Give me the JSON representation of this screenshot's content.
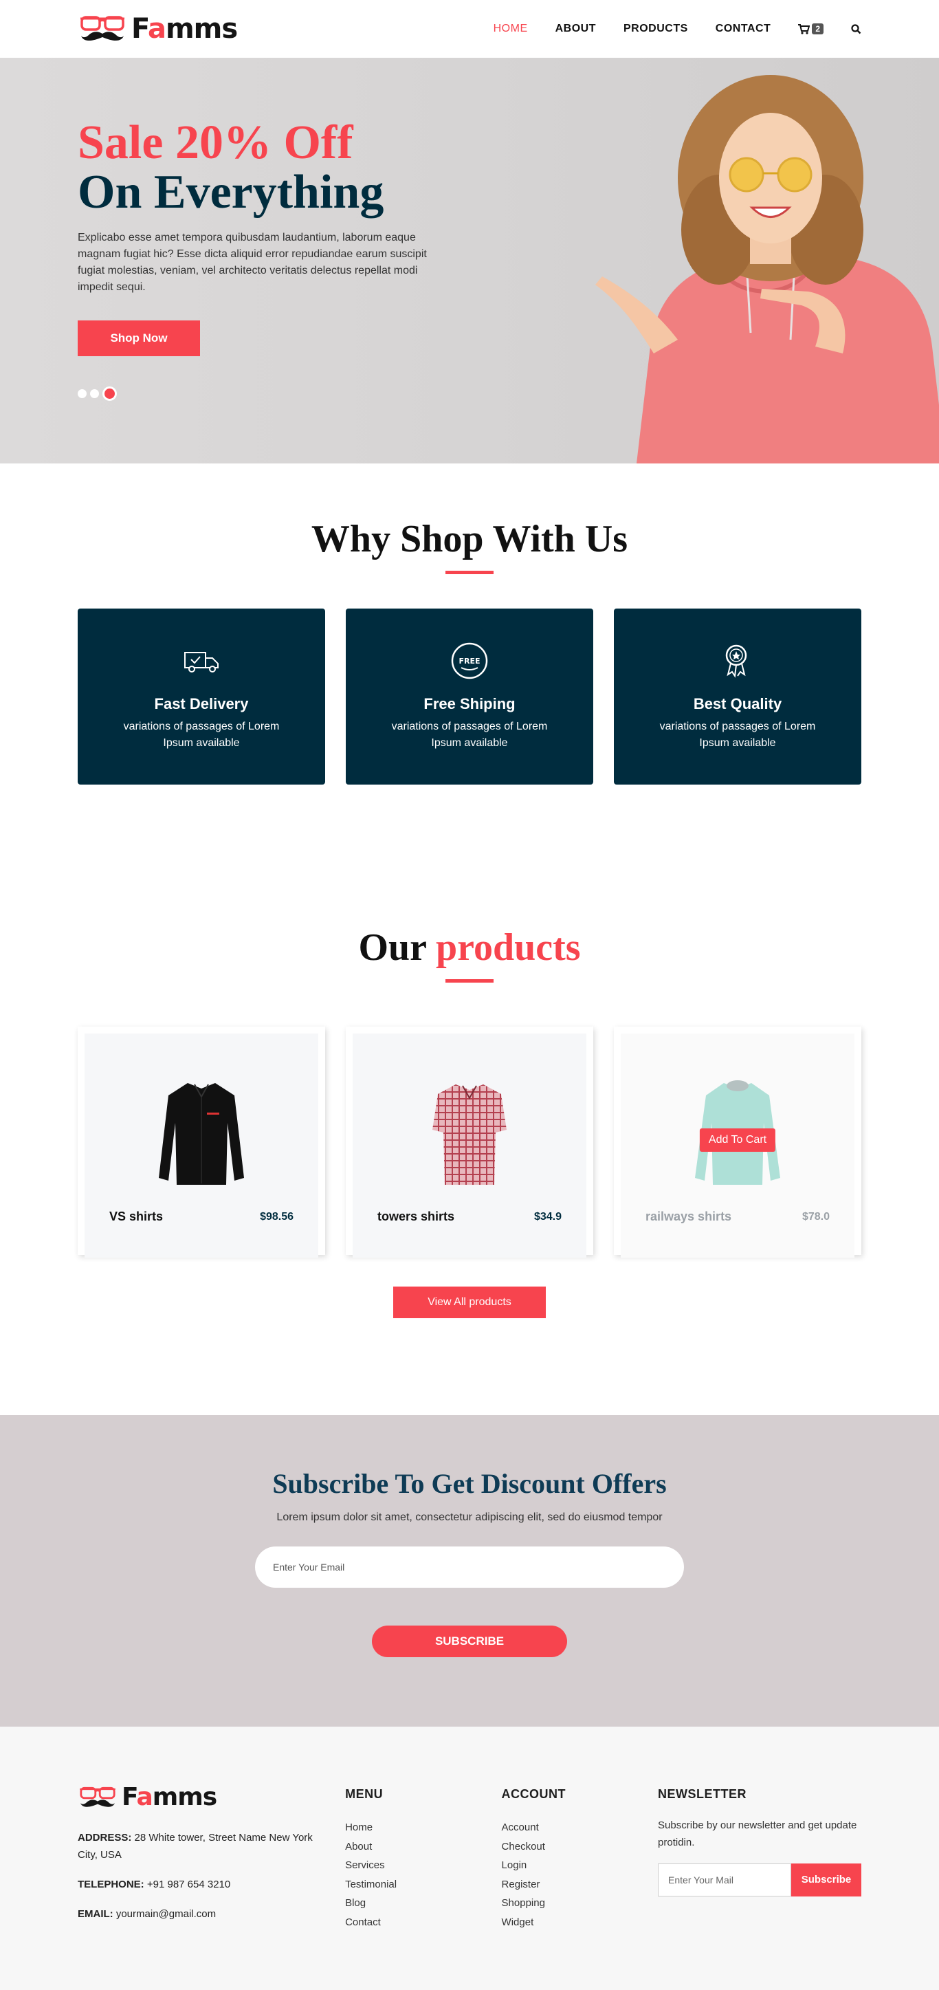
{
  "brand": {
    "name_start": "F",
    "name_accent": "a",
    "name_end": "mms"
  },
  "nav": {
    "items": [
      "HOME",
      "ABOUT",
      "PRODUCTS",
      "CONTACT"
    ],
    "cart_count": "2"
  },
  "hero": {
    "title_line1": "Sale 20% Off",
    "title_line2": "On Everything",
    "description": "Explicabo esse amet tempora quibusdam laudantium, laborum eaque magnam fugiat hic? Esse dicta aliquid error repudiandae earum suscipit fugiat molestias, veniam, vel architecto veritatis delectus repellat modi impedit sequi.",
    "button_label": "Shop Now",
    "slide_count": 3,
    "active_slide": 3
  },
  "why": {
    "title": "Why Shop With Us",
    "cards": [
      {
        "icon": "delivery-truck-icon",
        "title": "Fast Delivery",
        "text": "variations of passages of Lorem Ipsum available"
      },
      {
        "icon": "free-badge-icon",
        "title": "Free Shiping",
        "text": "variations of passages of Lorem Ipsum available"
      },
      {
        "icon": "quality-award-icon",
        "title": "Best Quality",
        "text": "variations of passages of Lorem Ipsum available"
      }
    ]
  },
  "products": {
    "title_plain": "Our",
    "title_accent": "products",
    "items": [
      {
        "name": "VS shirts",
        "price": "$98.56",
        "image": "black-shirt"
      },
      {
        "name": "towers shirts",
        "price": "$34.9",
        "image": "plaid-shirt"
      },
      {
        "name": "railways shirts",
        "price": "$78.0",
        "image": "mint-shirt",
        "hover_label": "Add To Cart"
      }
    ],
    "view_all_label": "View All products"
  },
  "subscribe": {
    "title": "Subscribe To Get Discount Offers",
    "text": "Lorem ipsum dolor sit amet, consectetur adipiscing elit, sed do eiusmod tempor",
    "placeholder": "Enter Your Email",
    "button_label": "SUBSCRIBE"
  },
  "footer": {
    "address_label": "ADDRESS:",
    "address": "28 White tower, Street Name New York City, USA",
    "telephone_label": "TELEPHONE:",
    "telephone": "+91 987 654 3210",
    "email_label": "EMAIL:",
    "email": "yourmain@gmail.com",
    "menu_title": "MENU",
    "menu": [
      "Home",
      "About",
      "Services",
      "Testimonial",
      "Blog",
      "Contact"
    ],
    "account_title": "ACCOUNT",
    "account": [
      "Account",
      "Checkout",
      "Login",
      "Register",
      "Shopping",
      "Widget"
    ],
    "newsletter_title": "NEWSLETTER",
    "newsletter_text": "Subscribe by our newsletter and get update protidin.",
    "newsletter_placeholder": "Enter Your Mail",
    "newsletter_button": "Subscribe"
  },
  "colors": {
    "accent": "#f7444e",
    "navy": "#002c3e",
    "subscribe_bg": "#d5ced0",
    "footer_bg": "#f7f7f7"
  }
}
